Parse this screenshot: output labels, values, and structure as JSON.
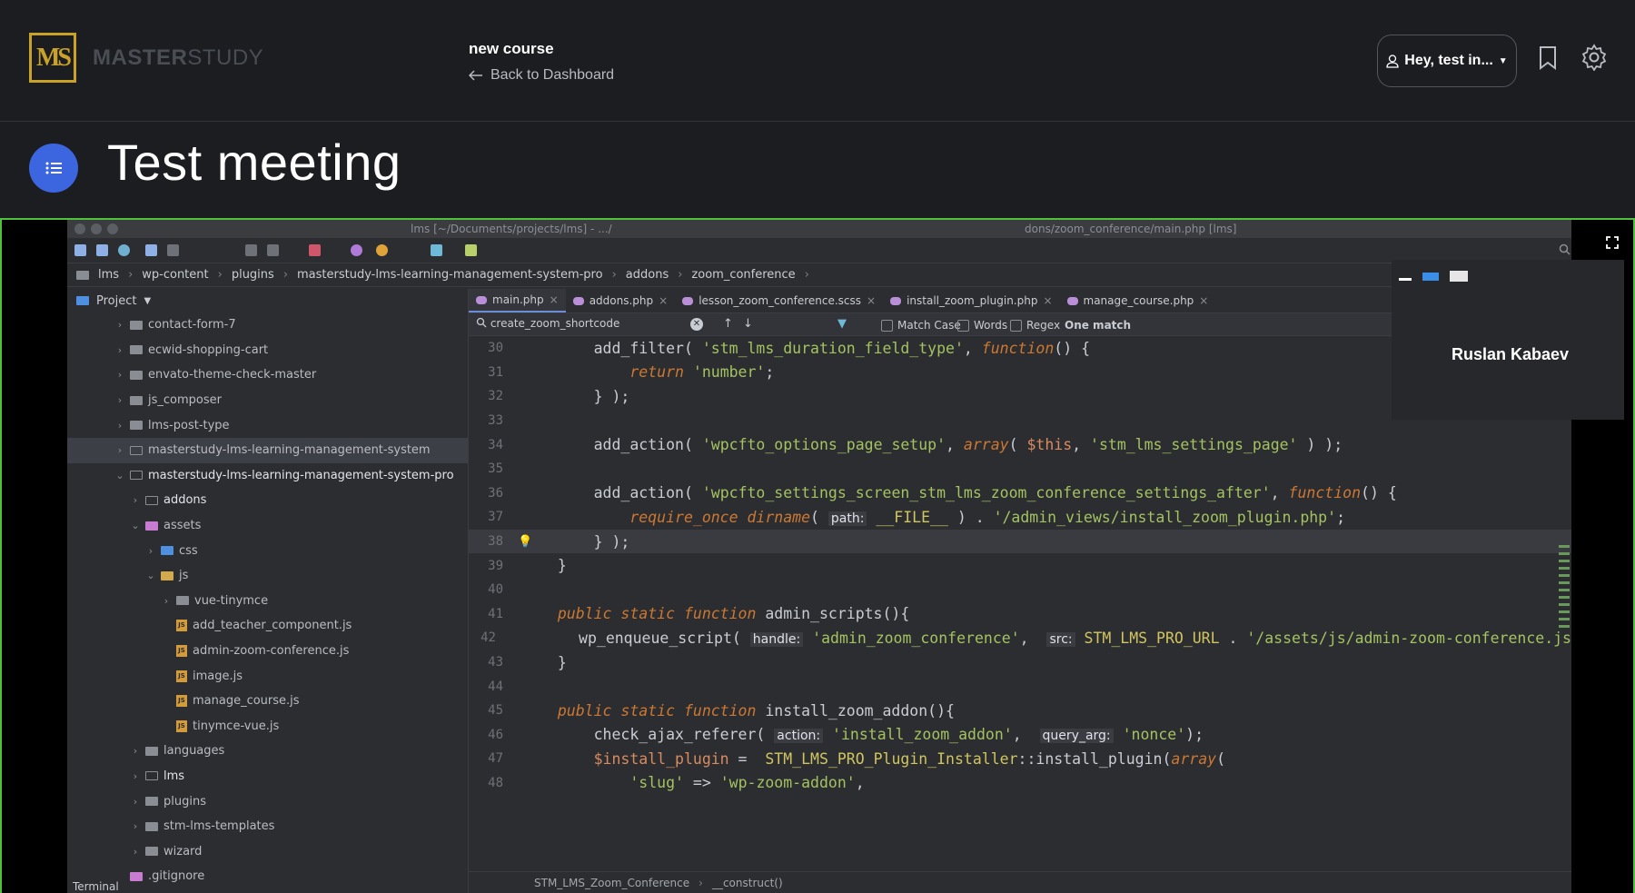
{
  "brand": {
    "logo_letters": "MS",
    "name_bold": "MASTER",
    "name_light": "STUDY"
  },
  "course": {
    "title": "new course",
    "back_label": "Back to Dashboard"
  },
  "user": {
    "greeting": "Hey, test in..."
  },
  "lesson": {
    "title": "Test meeting"
  },
  "participant": {
    "name": "Ruslan Kabaev"
  },
  "ide": {
    "title_left": "lms [~/Documents/projects/lms] - .../",
    "title_right": "dons/zoom_conference/main.php [lms]",
    "breadcrumbs": [
      "lms",
      "wp-content",
      "plugins",
      "masterstudy-lms-learning-management-system-pro",
      "addons",
      "zoom_conference"
    ],
    "project_label": "Project",
    "tree": [
      {
        "label": "contact-form-7",
        "indent": 1,
        "arrow": "›",
        "icon": "folder"
      },
      {
        "label": "ecwid-shopping-cart",
        "indent": 1,
        "arrow": "›",
        "icon": "folder"
      },
      {
        "label": "envato-theme-check-master",
        "indent": 1,
        "arrow": "›",
        "icon": "folder"
      },
      {
        "label": "js_composer",
        "indent": 1,
        "arrow": "›",
        "icon": "folder"
      },
      {
        "label": "lms-post-type",
        "indent": 1,
        "arrow": "›",
        "icon": "folder"
      },
      {
        "label": "masterstudy-lms-learning-management-system",
        "indent": 1,
        "arrow": "›",
        "icon": "outline",
        "selected": true
      },
      {
        "label": "masterstudy-lms-learning-management-system-pro",
        "indent": 1,
        "arrow": "⌄",
        "icon": "outline"
      },
      {
        "label": "addons",
        "indent": 2,
        "arrow": "›",
        "icon": "outline"
      },
      {
        "label": "assets",
        "indent": 2,
        "arrow": "⌄",
        "icon": "pink"
      },
      {
        "label": "css",
        "indent": 3,
        "arrow": "›",
        "icon": "blue"
      },
      {
        "label": "js",
        "indent": 3,
        "arrow": "⌄",
        "icon": "yellow"
      },
      {
        "label": "vue-tinymce",
        "indent": 4,
        "arrow": "›",
        "icon": "folder"
      },
      {
        "label": "add_teacher_component.js",
        "indent": 4,
        "arrow": "",
        "icon": "js"
      },
      {
        "label": "admin-zoom-conference.js",
        "indent": 4,
        "arrow": "",
        "icon": "js"
      },
      {
        "label": "image.js",
        "indent": 4,
        "arrow": "",
        "icon": "js"
      },
      {
        "label": "manage_course.js",
        "indent": 4,
        "arrow": "",
        "icon": "js"
      },
      {
        "label": "tinymce-vue.js",
        "indent": 4,
        "arrow": "",
        "icon": "js"
      },
      {
        "label": "languages",
        "indent": 2,
        "arrow": "›",
        "icon": "folder"
      },
      {
        "label": "lms",
        "indent": 2,
        "arrow": "›",
        "icon": "outline"
      },
      {
        "label": "plugins",
        "indent": 2,
        "arrow": "›",
        "icon": "folder"
      },
      {
        "label": "stm-lms-templates",
        "indent": 2,
        "arrow": "›",
        "icon": "folder"
      },
      {
        "label": "wizard",
        "indent": 2,
        "arrow": "›",
        "icon": "folder"
      },
      {
        "label": ".gitignore",
        "indent": 1,
        "arrow": "",
        "icon": "pink"
      }
    ],
    "tabs": [
      "main.php",
      "addons.php",
      "lesson_zoom_conference.scss",
      "install_zoom_plugin.php",
      "manage_course.php"
    ],
    "find": {
      "query": "create_zoom_shortcode",
      "match_case": "Match Case",
      "words": "Words",
      "regex": "Regex",
      "result": "One match"
    },
    "code_lines": [
      {
        "n": "30",
        "html": "      <span class='fn'>add_filter</span>( <span class='str'>'stm_lms_duration_field_type'</span>, <span class='kw'>function</span>() {"
      },
      {
        "n": "31",
        "html": "          <span class='kw'>return</span> <span class='str'>'number'</span>;"
      },
      {
        "n": "32",
        "html": "      } );"
      },
      {
        "n": "33",
        "html": ""
      },
      {
        "n": "34",
        "html": "      <span class='fn'>add_action</span>( <span class='str'>'wpcfto_options_page_setup'</span>, <span class='kw'>array</span>( <span class='var'>$this</span>, <span class='str'>'stm_lms_settings_page'</span> ) );"
      },
      {
        "n": "35",
        "html": ""
      },
      {
        "n": "36",
        "html": "      <span class='fn'>add_action</span>( <span class='str'>'wpcfto_settings_screen_stm_lms_zoom_conference_settings_after'</span>, <span class='kw'>function</span>() {"
      },
      {
        "n": "37",
        "html": "          <span class='kw'>require_once</span> <span class='kw'>dirname</span>( <span class='hint'>path:</span> <span class='cst'>__FILE__</span> ) . <span class='str'>'/admin_views/install_zoom_plugin.php'</span>;"
      },
      {
        "n": "38",
        "html": "      } );",
        "hl": true
      },
      {
        "n": "39",
        "html": "  }"
      },
      {
        "n": "40",
        "html": ""
      },
      {
        "n": "41",
        "html": "  <span class='kw'>public static function</span> admin_scripts(){"
      },
      {
        "n": "42",
        "html": "      <span class='fn'>wp_enqueue_script</span>( <span class='hint'>handle:</span> <span class='str'>'admin_zoom_conference'</span>,  <span class='hint'>src:</span> <span class='cst'>STM_LMS_PRO_URL</span> . <span class='str'>'/assets/js/admin-zoom-conference.js</span>"
      },
      {
        "n": "43",
        "html": "  }"
      },
      {
        "n": "44",
        "html": ""
      },
      {
        "n": "45",
        "html": "  <span class='kw'>public static function</span> install_zoom_addon(){"
      },
      {
        "n": "46",
        "html": "      <span class='fn'>check_ajax_referer</span>( <span class='hint'>action:</span> <span class='str'>'install_zoom_addon'</span>,  <span class='hint'>query_arg:</span> <span class='str'>'nonce'</span>);"
      },
      {
        "n": "47",
        "html": "      <span class='var'>$install_plugin</span> =  <span class='cst'>STM_LMS_PRO_Plugin_Installer</span>::install_plugin(<span class='kw'>array</span>("
      },
      {
        "n": "48",
        "html": "          <span class='str'>'slug'</span> => <span class='str'>'wp-zoom-addon'</span>,"
      }
    ],
    "footer_crumbs": [
      "STM_LMS_Zoom_Conference",
      "__construct()"
    ],
    "terminal_label": "Terminal"
  },
  "colors": {
    "accent_blue": "#3c66e0",
    "live_green": "#4fc23b",
    "brand_gold": "#c9a227"
  }
}
